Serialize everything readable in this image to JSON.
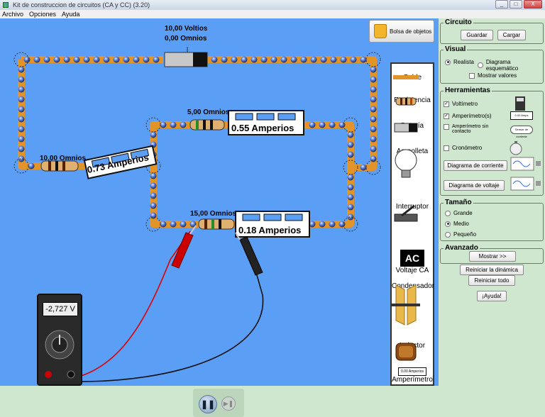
{
  "window": {
    "title": "Kit de construccion de circuitos (CA y CC) (3.20)",
    "minimize": "_",
    "maximize": "□",
    "close": "X"
  },
  "menu": [
    "Archivo",
    "Opciones",
    "Ayuda"
  ],
  "canvas": {
    "bag_button": "Bolsa de objetos",
    "top_voltage": "10,00 Voltios",
    "top_resistance": "0,00 Omnios",
    "r_left": "10,00 Omnios",
    "r_mid": "5,00 Omnios",
    "r_bottom": "15,00 Omnios",
    "amm_left": "0.73 Amperios",
    "amm_mid": "0.55 Amperios",
    "amm_bottom": "0.18 Amperios",
    "voltmeter_reading": "-2,727 V"
  },
  "toolbox": [
    "Cable",
    "Resistencia",
    "Batería",
    "Ampolleta",
    "Interruptor",
    "Voltaje CA",
    "Condensador",
    "Inductor",
    "Amperímetro"
  ],
  "toolbox_ac_label": "AC",
  "toolbox_ammeter_display": "0.00 Amperios",
  "panel": {
    "circuito": {
      "title": "Circuito",
      "save": "Guardar",
      "load": "Cargar"
    },
    "visual": {
      "title": "Visual",
      "realista": "Realista",
      "esquematico": "Diagrama esquemático",
      "mostrar_valores": "Mostrar valores"
    },
    "herramientas": {
      "title": "Herramientas",
      "voltimetro": "Voltímetro",
      "amperimetros": "Amperímetro(s)",
      "amperimetro_sin_contacto": "Amperímetro sin contacto",
      "cronometro": "Cronómetro",
      "diagrama_corriente": "Diagrama de corriente",
      "diagrama_voltaje": "Diagrama de voltaje",
      "amm_icon_text": "0.00 Amps",
      "contact_icon_text": "Sensor de corriente"
    },
    "tamano": {
      "title": "Tamaño",
      "grande": "Grande",
      "medio": "Medio",
      "pequeno": "Pequeño"
    },
    "avanzado": {
      "title": "Avanzado",
      "mostrar": "Mostrar >>"
    },
    "reiniciar_dinamica": "Reiniciar la dinámica",
    "reiniciar_todo": "Reiniciar todo",
    "ayuda": "¡Ayuda!"
  },
  "playback": {
    "pause_icon": "❚❚",
    "step_icon": "▶❚"
  }
}
